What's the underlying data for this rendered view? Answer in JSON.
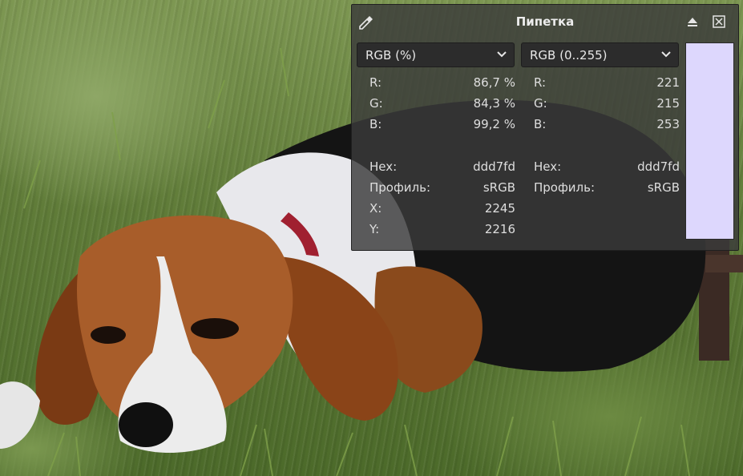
{
  "dock": {
    "title": "Пипетка",
    "icon": "eyedropper-icon",
    "float_button_icon": "float-eject-icon",
    "close_button_icon": "close-box-icon",
    "left_model": "RGB (%)",
    "right_model": "RGB (0..255)",
    "swatch_color": "#ddd7fd",
    "left_values": {
      "r_label": "R:",
      "r_value": "86,7 %",
      "g_label": "G:",
      "g_value": "84,3 %",
      "b_label": "B:",
      "b_value": "99,2 %",
      "hex_label": "Hex:",
      "hex_value": "ddd7fd",
      "profile_label": "Профиль:",
      "profile_value": "sRGB",
      "x_label": "X:",
      "x_value": "2245",
      "y_label": "Y:",
      "y_value": "2216"
    },
    "right_values": {
      "r_label": "R:",
      "r_value": "221",
      "g_label": "G:",
      "g_value": "215",
      "b_label": "B:",
      "b_value": "253",
      "hex_label": "Hex:",
      "hex_value": "ddd7fd",
      "profile_label": "Профиль:",
      "profile_value": "sRGB"
    }
  },
  "colors": {
    "panel_bg": "#3a3a3a",
    "text": "#e6e6e6",
    "swatch": "#ddd7fd"
  }
}
